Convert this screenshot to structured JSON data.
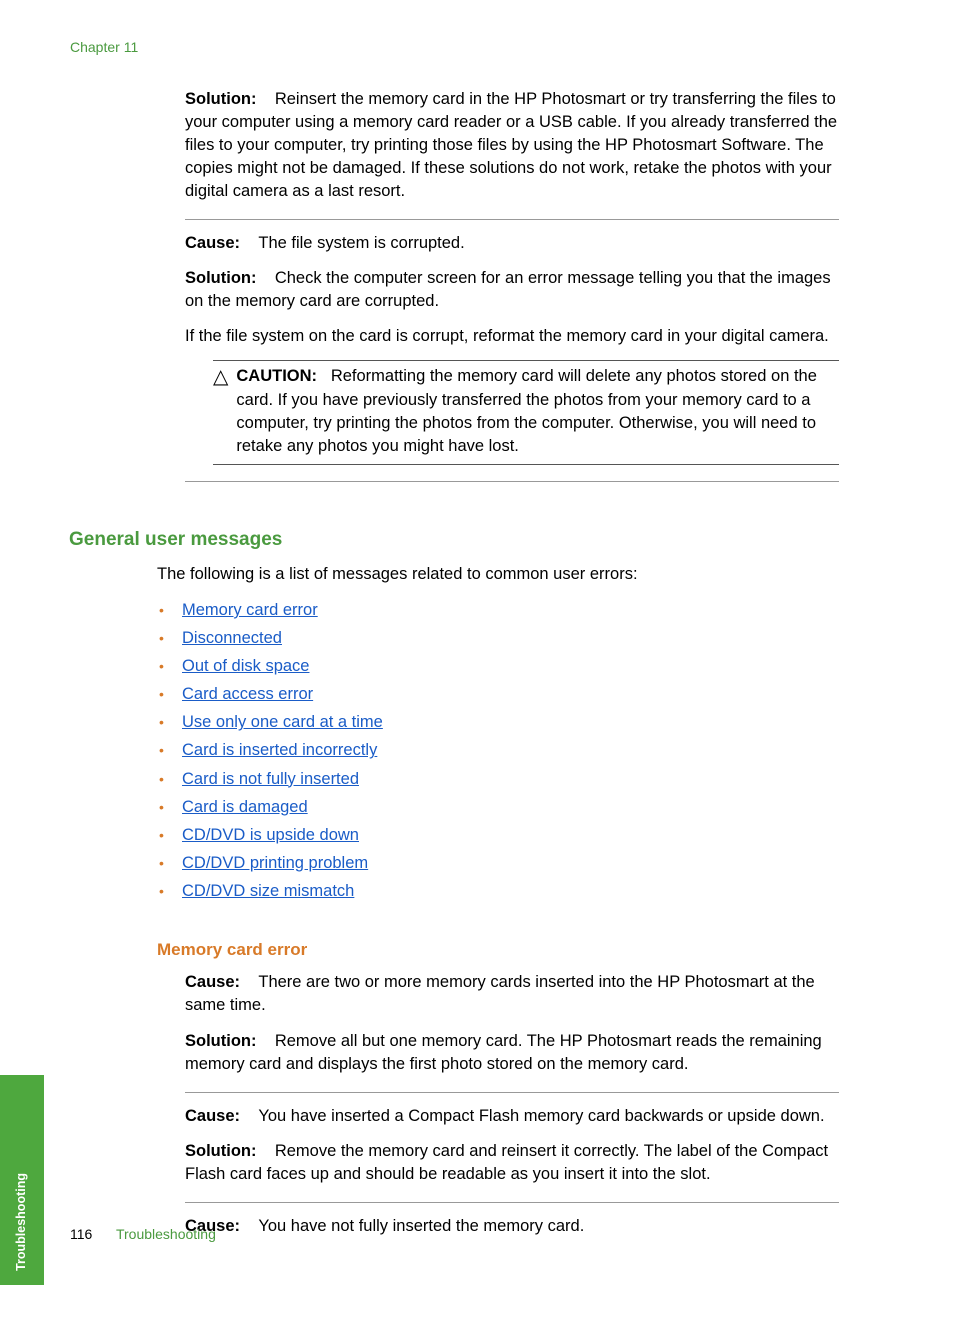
{
  "chapter_header": "Chapter 11",
  "block1": {
    "solution_label": "Solution:",
    "solution_text": "Reinsert the memory card in the HP Photosmart or try transferring the files to your computer using a memory card reader or a USB cable. If you already transferred the files to your computer, try printing those files by using the HP Photosmart Software. The copies might not be damaged. If these solutions do not work, retake the photos with your digital camera as a last resort."
  },
  "block2": {
    "cause_label": "Cause:",
    "cause_text": "The file system is corrupted.",
    "solution_label": "Solution:",
    "solution_text": "Check the computer screen for an error message telling you that the images on the memory card are corrupted.",
    "extra": "If the file system on the card is corrupt, reformat the memory card in your digital camera.",
    "caution_label": "CAUTION:",
    "caution_text": "Reformatting the memory card will delete any photos stored on the card. If you have previously transferred the photos from your memory card to a computer, try printing the photos from the computer. Otherwise, you will need to retake any photos you might have lost."
  },
  "general_heading": "General user messages",
  "general_intro": "The following is a list of messages related to common user errors:",
  "links": [
    "Memory card error",
    "Disconnected",
    "Out of disk space",
    "Card access error",
    "Use only one card at a time",
    "Card is inserted incorrectly",
    "Card is not fully inserted",
    "Card is damaged",
    "CD/DVD is upside down",
    "CD/DVD printing problem",
    "CD/DVD size mismatch"
  ],
  "memory_heading": "Memory card error",
  "mc1": {
    "cause_label": "Cause:",
    "cause_text": "There are two or more memory cards inserted into the HP Photosmart at the same time.",
    "solution_label": "Solution:",
    "solution_text": "Remove all but one memory card. The HP Photosmart reads the remaining memory card and displays the first photo stored on the memory card."
  },
  "mc2": {
    "cause_label": "Cause:",
    "cause_text": "You have inserted a Compact Flash memory card backwards or upside down.",
    "solution_label": "Solution:",
    "solution_text": "Remove the memory card and reinsert it correctly. The label of the Compact Flash card faces up and should be readable as you insert it into the slot."
  },
  "mc3": {
    "cause_label": "Cause:",
    "cause_text": "You have not fully inserted the memory card."
  },
  "side_tab": "Troubleshooting",
  "footer": {
    "page": "116",
    "title": "Troubleshooting"
  }
}
